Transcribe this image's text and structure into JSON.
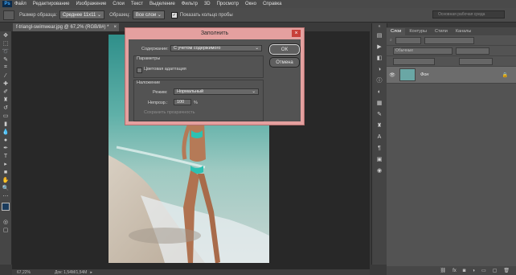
{
  "app": {
    "logo": "Ps"
  },
  "menu": [
    "Файл",
    "Редактирование",
    "Изображение",
    "Слои",
    "Текст",
    "Выделение",
    "Фильтр",
    "3D",
    "Просмотр",
    "Окно",
    "Справка"
  ],
  "options": {
    "sample_size_label": "Размер образца:",
    "sample_size_value": "Среднее 11x11",
    "sample_label": "Образец:",
    "sample_value": "Все слои",
    "show_ring_label": "Показать кольцо пробы",
    "search_placeholder": "Основная рабочая среда"
  },
  "document": {
    "tab_title": "f-triangl-swimwear.jpg @ 67,2% (RGB/8#) *",
    "zoom": "67,22%",
    "doc_info": "Док: 1,54M/1,54M"
  },
  "dialog": {
    "title": "Заполнить",
    "content_label": "Содержание:",
    "content_value": "С учетом содержимого",
    "params_label": "Параметры",
    "color_adapt_label": "Цветовая адаптация",
    "blend_label": "Наложение",
    "mode_label": "Режим:",
    "mode_value": "Нормальный",
    "opacity_label": "Непрозр.:",
    "opacity_value": "100",
    "opacity_unit": "%",
    "preserve_label": "Сохранить прозрачность",
    "ok_label": "ОК",
    "cancel_label": "Отмена",
    "close_glyph": "×"
  },
  "panel": {
    "tabs": [
      "Слои",
      "Контуры",
      "Стили",
      "Каналы"
    ],
    "kind_value": "Обычные",
    "layer_name": "Фон",
    "lock_glyph": "🔒",
    "eye_glyph": "👁"
  },
  "colors": {
    "dialog_border": "#e4a09f",
    "close": "#c7403a"
  }
}
